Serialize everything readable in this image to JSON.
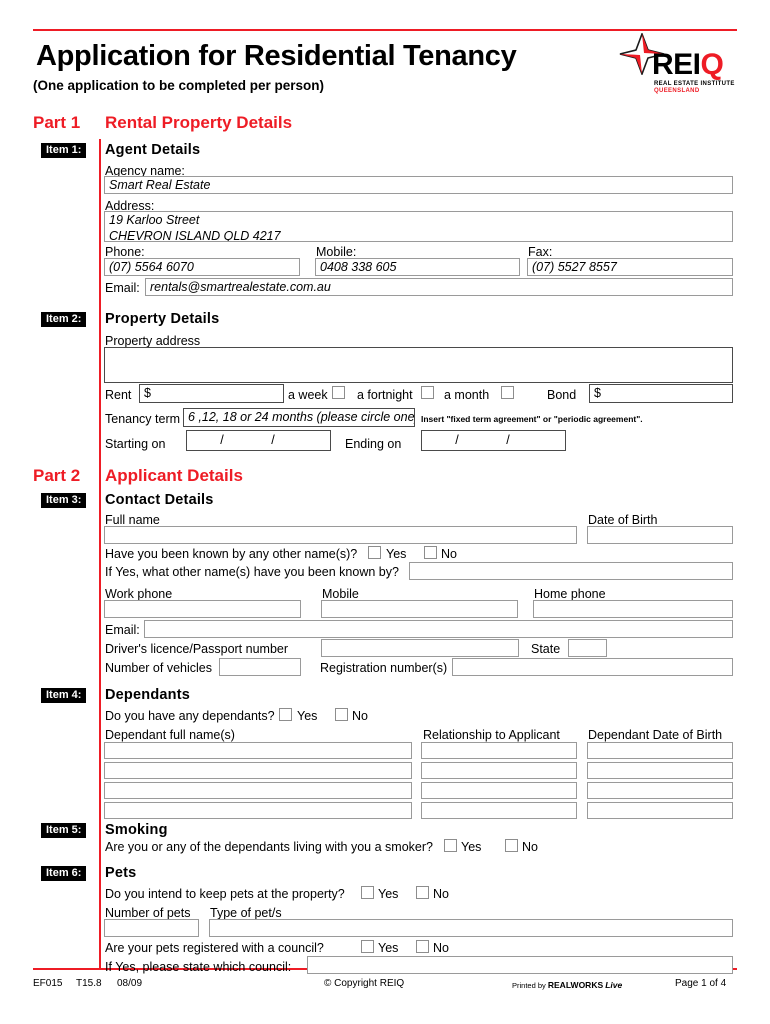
{
  "document": {
    "title": "Application for Residential Tenancy",
    "subtitle": "(One application to be completed per person)",
    "accent_color": "#ee1c25"
  },
  "logo": {
    "wordmark_rei": "REI",
    "wordmark_q": "Q",
    "tagline_line1": "REAL ESTATE INSTITUTE",
    "tagline_line2": "QUEENSLAND"
  },
  "parts": {
    "part1": {
      "label": "Part 1",
      "title": "Rental Property Details"
    },
    "part2": {
      "label": "Part 2",
      "title": "Applicant Details"
    }
  },
  "item1": {
    "badge": "Item 1:",
    "heading": "Agent Details",
    "agency_name_label": "Agency name:",
    "agency_name_value": "Smart Real Estate",
    "address_label": "Address:",
    "address_line1": "19 Karloo Street",
    "address_line2": "CHEVRON ISLAND QLD 4217",
    "phone_label": "Phone:",
    "phone_value": "(07) 5564 6070",
    "mobile_label": "Mobile:",
    "mobile_value": "0408 338 605",
    "fax_label": "Fax:",
    "fax_value": "(07) 5527 8557",
    "email_label": "Email:",
    "email_value": "rentals@smartrealestate.com.au"
  },
  "item2": {
    "badge": "Item 2:",
    "heading": "Property Details",
    "property_address_label": "Property address",
    "property_address_value": "",
    "rent_label": "Rent",
    "rent_currency": "$",
    "rent_value": "",
    "period_week": "a week",
    "period_fortnight": "a fortnight",
    "period_month": "a month",
    "bond_label": "Bond",
    "bond_currency": "$",
    "bond_value": "",
    "tenancy_term_label": "Tenancy term",
    "tenancy_term_value": "6 ,12, 18 or 24 months (please circle one)",
    "tenancy_term_note": "Insert \"fixed term agreement\" or \"periodic agreement\".",
    "starting_on_label": "Starting on",
    "starting_on_value": "/          /",
    "ending_on_label": "Ending on",
    "ending_on_value": "/          /"
  },
  "item3": {
    "badge": "Item 3:",
    "heading": "Contact Details",
    "full_name_label": "Full name",
    "full_name_value": "",
    "dob_label": "Date of Birth",
    "dob_value": "",
    "other_names_question": "Have you been known by any other name(s)?",
    "yes_label": "Yes",
    "no_label": "No",
    "other_names_followup": "If Yes, what other name(s) have you been known by?",
    "other_names_value": "",
    "work_phone_label": "Work phone",
    "work_phone_value": "",
    "mobile_label": "Mobile",
    "mobile_value": "",
    "home_phone_label": "Home phone",
    "home_phone_value": "",
    "email_label": "Email:",
    "email_value": "",
    "licence_label": "Driver's licence/Passport number",
    "licence_value": "",
    "state_label": "State",
    "state_value": "",
    "vehicles_label": "Number of vehicles",
    "vehicles_value": "",
    "registration_label": "Registration number(s)",
    "registration_value": ""
  },
  "item4": {
    "badge": "Item 4:",
    "heading": "Dependants",
    "question": "Do you have any dependants?",
    "yes_label": "Yes",
    "no_label": "No",
    "col_name": "Dependant full name(s)",
    "col_relationship": "Relationship to Applicant",
    "col_dob": "Dependant Date of Birth",
    "rows": [
      {
        "name": "",
        "relationship": "",
        "dob": ""
      },
      {
        "name": "",
        "relationship": "",
        "dob": ""
      },
      {
        "name": "",
        "relationship": "",
        "dob": ""
      },
      {
        "name": "",
        "relationship": "",
        "dob": ""
      }
    ]
  },
  "item5": {
    "badge": "Item 5:",
    "heading": "Smoking",
    "question": "Are you or any of the dependants living with you a smoker?",
    "yes_label": "Yes",
    "no_label": "No"
  },
  "item6": {
    "badge": "Item 6:",
    "heading": "Pets",
    "question": "Do you intend to keep pets at the property?",
    "yes_label": "Yes",
    "no_label": "No",
    "number_label": "Number of pets",
    "number_value": "",
    "type_label": "Type of pet/s",
    "type_value": "",
    "council_question": "Are your pets registered with a council?",
    "council_yes_label": "Yes",
    "council_no_label": "No",
    "council_followup": "If Yes, please state which council:",
    "council_value": ""
  },
  "footer": {
    "form_code": "EF015",
    "version": "T15.8",
    "date": "08/09",
    "copyright": "© Copyright REIQ",
    "printed_by_prefix": "Printed by",
    "printed_by_brand": "REALWORKS",
    "printed_by_product": "Live",
    "page": "Page 1 of 4"
  }
}
